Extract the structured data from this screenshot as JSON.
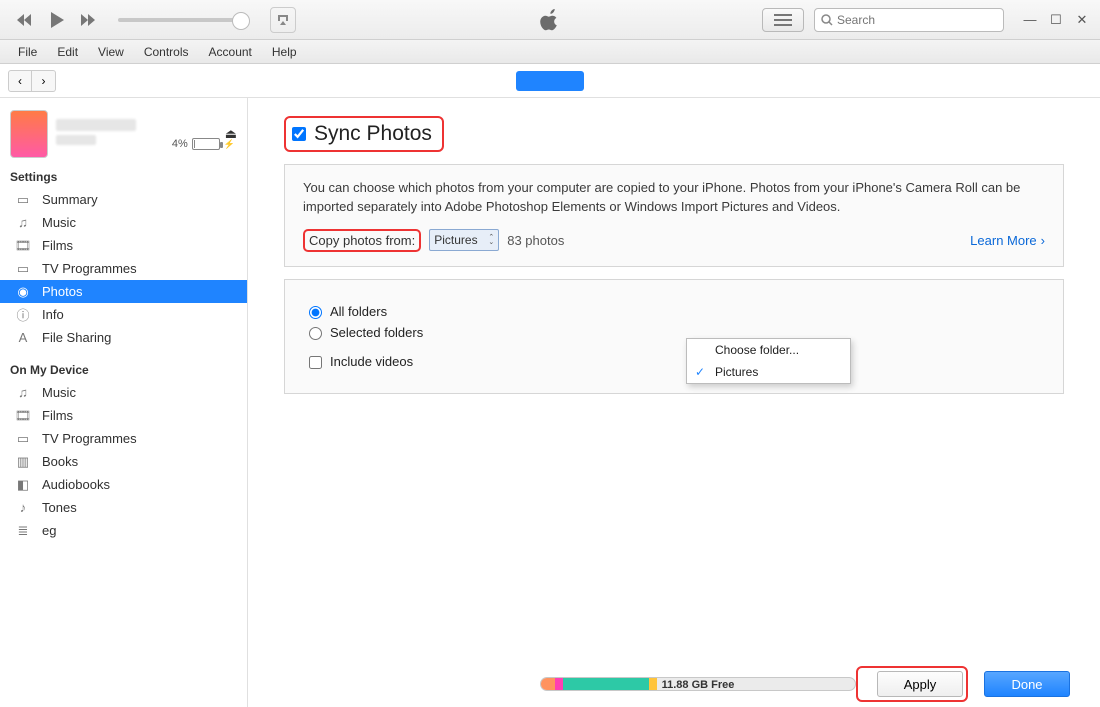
{
  "menubar": [
    "File",
    "Edit",
    "View",
    "Controls",
    "Account",
    "Help"
  ],
  "search": {
    "placeholder": "Search"
  },
  "device": {
    "battery_pct": "4%"
  },
  "sidebar": {
    "section_settings": "Settings",
    "settings": [
      {
        "label": "Summary"
      },
      {
        "label": "Music"
      },
      {
        "label": "Films"
      },
      {
        "label": "TV Programmes"
      },
      {
        "label": "Photos"
      },
      {
        "label": "Info"
      },
      {
        "label": "File Sharing"
      }
    ],
    "section_device": "On My Device",
    "ondevice": [
      {
        "label": "Music"
      },
      {
        "label": "Films"
      },
      {
        "label": "TV Programmes"
      },
      {
        "label": "Books"
      },
      {
        "label": "Audiobooks"
      },
      {
        "label": "Tones"
      },
      {
        "label": "eg"
      }
    ]
  },
  "main": {
    "sync_title": "Sync Photos",
    "description": "You can choose which photos from your computer are copied to your iPhone. Photos from your iPhone's Camera Roll can be imported separately into Adobe Photoshop Elements or Windows Import Pictures and Videos.",
    "copy_label": "Copy photos from:",
    "folder_value": "Pictures",
    "photo_count": "83 photos",
    "learn_more": "Learn More",
    "dropdown": {
      "opt1": "Choose folder...",
      "opt2": "Pictures"
    },
    "opt_all": "All folders",
    "opt_selected": "Selected folders",
    "opt_videos": "Include videos"
  },
  "bottom": {
    "free": "11.88 GB Free",
    "apply": "Apply",
    "done": "Done"
  }
}
